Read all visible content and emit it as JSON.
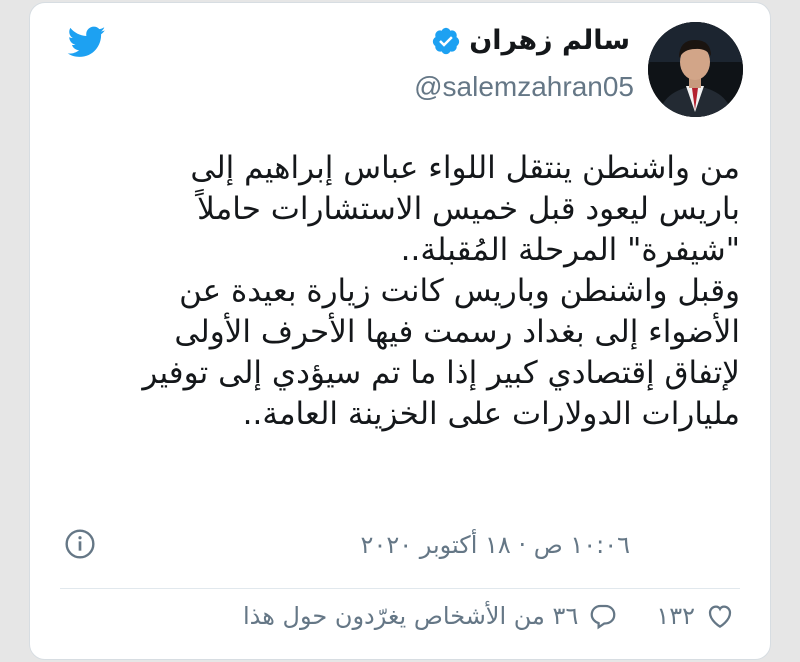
{
  "user": {
    "name": "سالم زهران",
    "handle": "@salemzahran05"
  },
  "tweet": {
    "lines": [
      "من واشنطن ينتقل اللواء عباس إبراهيم إلى",
      "باريس ليعود قبل خميس الاستشارات حاملاً",
      "\"شيفرة\" المرحلة المُقبلة..",
      "وقبل واشنطن وباريس كانت زيارة بعيدة عن",
      "الأضواء إلى بغداد رسمت فيها الأحرف الأولى",
      "لإتفاق إقتصادي كبير إذا ما تم سيؤدي إلى توفير",
      "مليارات الدولارات على الخزينة العامة.."
    ],
    "timestamp": "١٠:٠٦ ص · ١٨ أكتوبر ٢٠٢٠"
  },
  "actions": {
    "likes": "١٣٢",
    "replies_label": "٣٦ من الأشخاص يغرّدون حول هذا"
  },
  "colors": {
    "twitter_blue": "#1da1f2",
    "text": "#14171a",
    "secondary": "#657786"
  },
  "icons": [
    "twitter-bird-icon",
    "verified-badge-icon",
    "info-icon",
    "heart-icon",
    "reply-bubble-icon"
  ]
}
